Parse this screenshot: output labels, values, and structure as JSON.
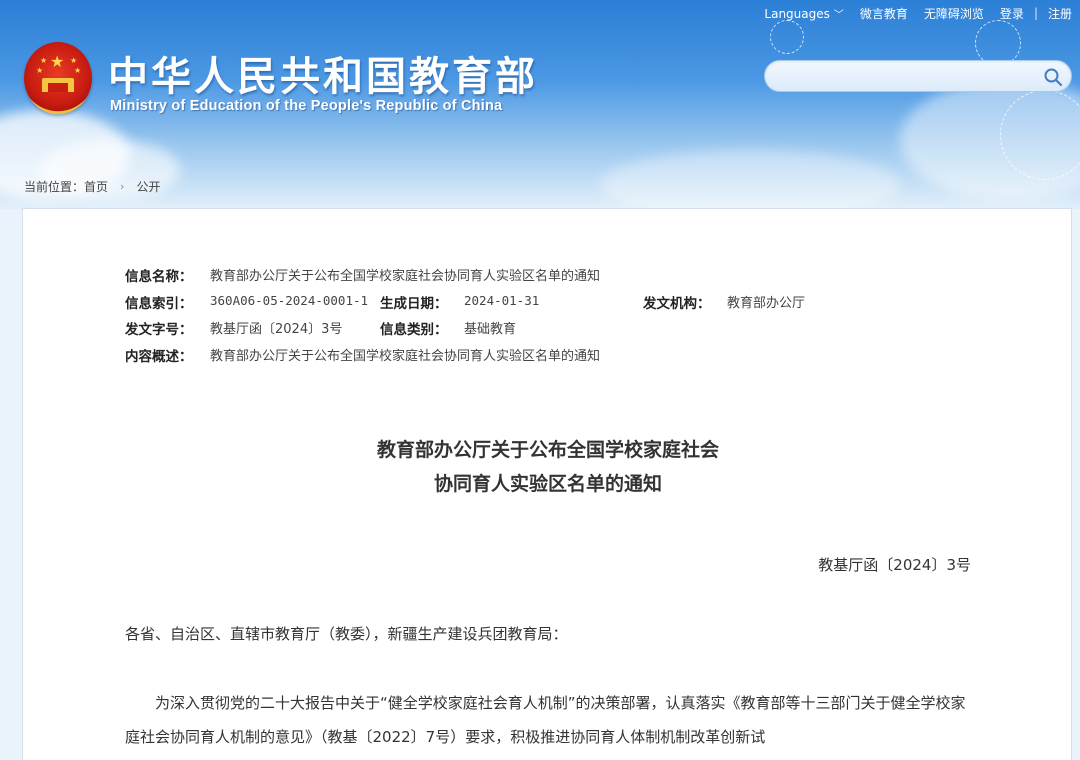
{
  "topnav": {
    "languages": "Languages",
    "weiyan": "微言教育",
    "accessibility": "无障碍浏览",
    "login": "登录",
    "separator": "|",
    "register": "注册"
  },
  "site": {
    "title_cn": "中华人民共和国教育部",
    "title_en": "Ministry of Education of the People's Republic of China"
  },
  "search": {
    "placeholder": ""
  },
  "breadcrumb": {
    "prefix": "当前位置：",
    "home": "首页",
    "current": "公开"
  },
  "meta": {
    "name_label": "信息名称：",
    "name_value": "教育部办公厅关于公布全国学校家庭社会协同育人实验区名单的通知",
    "index_label": "信息索引：",
    "index_value": "360A06-05-2024-0001-1",
    "date_label": "生成日期：",
    "date_value": "2024-01-31",
    "org_label": "发文机构：",
    "org_value": "教育部办公厅",
    "docno_label": "发文字号：",
    "docno_value": "教基厅函〔2024〕3号",
    "category_label": "信息类别：",
    "category_value": "基础教育",
    "summary_label": "内容概述：",
    "summary_value": "教育部办公厅关于公布全国学校家庭社会协同育人实验区名单的通知"
  },
  "document": {
    "title_line1": "教育部办公厅关于公布全国学校家庭社会",
    "title_line2": "协同育人实验区名单的通知",
    "doc_number": "教基厅函〔2024〕3号",
    "salutation": "各省、自治区、直辖市教育厅（教委），新疆生产建设兵团教育局：",
    "paragraph1": "为深入贯彻党的二十大报告中关于“健全学校家庭社会育人机制”的决策部署，认真落实《教育部等十三部门关于健全学校家庭社会协同育人机制的意见》（教基〔2022〕7号）要求，积极推进协同育人体制机制改革创新试"
  },
  "colors": {
    "header_blue": "#2b7fd6",
    "emblem_red": "#c91d12",
    "emblem_gold": "#f2c23a"
  }
}
